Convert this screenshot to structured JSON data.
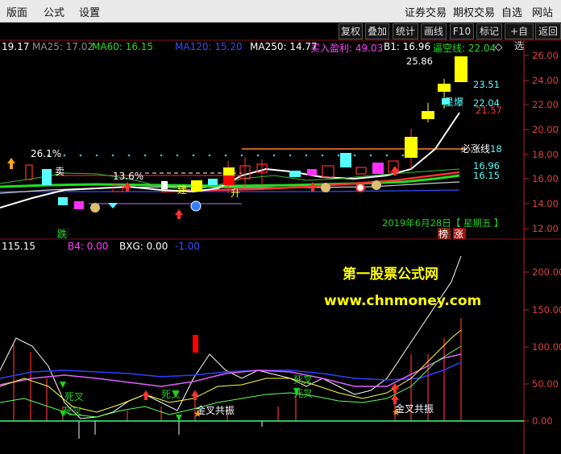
{
  "menu": {
    "left": [
      "版面",
      "公式",
      "设置"
    ],
    "right": [
      "证券交易",
      "期权交易",
      "自选",
      "网站"
    ]
  },
  "toolbar": [
    "复权",
    "叠加",
    "统计",
    "画线",
    "F10",
    "标记",
    "+自选",
    "返回"
  ],
  "main_indicator": {
    "ma_first": "19.17",
    "ma25": "MA25: 17.02",
    "ma60": "MA60: 16.15",
    "ma120": "MA120: 15.20",
    "ma250": "MA250: 14.77",
    "buy_profit": "买入盈利: 49.03",
    "b1": "B1: 16.96",
    "force_line": "逼空线: 22.04",
    "diamond": "◇"
  },
  "main_axis": [
    "26.00",
    "24.00",
    "22.00",
    "20.00",
    "18.00",
    "16.00",
    "14.00",
    "12.00"
  ],
  "main_labels": {
    "high": "25.86",
    "p1": "23.51",
    "p2": "22.04",
    "p3": "21.57",
    "p4": "18",
    "p5": "16.96",
    "p6": "16.15",
    "must_rise": "必涨线",
    "pct1": "26.1%",
    "pct2": "13.6%",
    "sell": "卖",
    "build": "建",
    "rise": "升",
    "star_peak": "星爆",
    "date": "2019年6月28日【 星期五 】",
    "die": "跌",
    "rank": "榜",
    "zhang": "涨"
  },
  "sub_indicator": {
    "value": "115.15",
    "b4": "B4: 0.00",
    "bxg": "BXG: 0.00",
    "neg": "-1.00"
  },
  "sub_axis": [
    "200.00",
    "150.00",
    "100.00",
    "50.00",
    "0.00"
  ],
  "watermark": {
    "line1": "第一股票公式网",
    "line2": "www.chnmoney.com"
  },
  "sub_labels": {
    "dead_cross": "死叉",
    "gold_resonance": "金叉共振"
  },
  "colors": {
    "up": "#ff3232",
    "down": "#54ffff",
    "axis": "#c02020",
    "ma25": "#888888",
    "ma60": "#20e020",
    "ma120": "#3050ff",
    "yellow": "#ffff00"
  }
}
